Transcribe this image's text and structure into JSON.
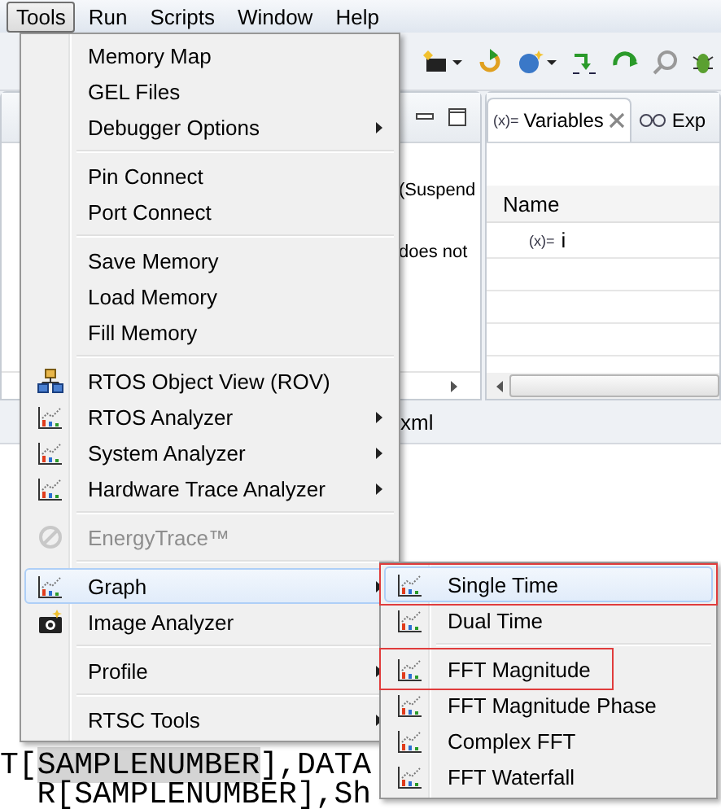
{
  "menubar": [
    {
      "label": "Tools",
      "selected": true
    },
    {
      "label": "Run",
      "selected": false
    },
    {
      "label": "Scripts",
      "selected": false
    },
    {
      "label": "Window",
      "selected": false
    },
    {
      "label": "Help",
      "selected": false
    }
  ],
  "debug_panel": {
    "texts": [
      "(Suspend",
      "does not"
    ]
  },
  "variables_panel": {
    "tabs": [
      {
        "label": "Variables",
        "icon_text": "(x)=",
        "selected": true
      },
      {
        "label": "Exp",
        "selected": false
      }
    ],
    "column": "Name",
    "rows": [
      {
        "icon_text": "(x)=",
        "name": "i"
      }
    ]
  },
  "editor_tab": {
    "label": "xml"
  },
  "code_lines": [
    {
      "parts": [
        {
          "text": "T[",
          "highlighted": false
        },
        {
          "text": "SAMPLENUMBER",
          "highlighted": true
        },
        {
          "text": "],DATA",
          "highlighted": false
        }
      ]
    },
    {
      "parts": [
        {
          "text": "  R[",
          "highlighted": false
        },
        {
          "text": "SAMPLENUMBER",
          "highlighted": false
        },
        {
          "text": "],Sh",
          "highlighted": false
        }
      ]
    }
  ],
  "tools_menu": {
    "items": [
      {
        "kind": "plain",
        "label": "Memory Map",
        "submenu": false,
        "disabled": false,
        "highlighted": false
      },
      {
        "kind": "plain",
        "label": "GEL Files",
        "submenu": false,
        "disabled": false,
        "highlighted": false
      },
      {
        "kind": "plain",
        "label": "Debugger Options",
        "submenu": true,
        "disabled": false,
        "highlighted": false
      },
      {
        "kind": "separator"
      },
      {
        "kind": "plain",
        "label": "Pin Connect",
        "submenu": false,
        "disabled": false,
        "highlighted": false
      },
      {
        "kind": "plain",
        "label": "Port Connect",
        "submenu": false,
        "disabled": false,
        "highlighted": false
      },
      {
        "kind": "separator"
      },
      {
        "kind": "plain",
        "label": "Save Memory",
        "submenu": false,
        "disabled": false,
        "highlighted": false
      },
      {
        "kind": "plain",
        "label": "Load Memory",
        "submenu": false,
        "disabled": false,
        "highlighted": false
      },
      {
        "kind": "plain",
        "label": "Fill Memory",
        "submenu": false,
        "disabled": false,
        "highlighted": false
      },
      {
        "kind": "separator"
      },
      {
        "kind": "hierarchy",
        "label": "RTOS Object View (ROV)",
        "submenu": false,
        "disabled": false,
        "highlighted": false
      },
      {
        "kind": "chart",
        "label": "RTOS Analyzer",
        "submenu": true,
        "disabled": false,
        "highlighted": false
      },
      {
        "kind": "chart",
        "label": "System Analyzer",
        "submenu": true,
        "disabled": false,
        "highlighted": false
      },
      {
        "kind": "chart",
        "label": "Hardware Trace Analyzer",
        "submenu": true,
        "disabled": false,
        "highlighted": false
      },
      {
        "kind": "separator"
      },
      {
        "kind": "gauge",
        "label": "EnergyTrace™",
        "submenu": false,
        "disabled": true,
        "highlighted": false
      },
      {
        "kind": "separator"
      },
      {
        "kind": "chart",
        "label": "Graph",
        "submenu": true,
        "disabled": false,
        "highlighted": true
      },
      {
        "kind": "camera",
        "label": "Image Analyzer",
        "submenu": false,
        "disabled": false,
        "highlighted": false
      },
      {
        "kind": "separator"
      },
      {
        "kind": "plain",
        "label": "Profile",
        "submenu": true,
        "disabled": false,
        "highlighted": false
      },
      {
        "kind": "separator"
      },
      {
        "kind": "plain",
        "label": "RTSC Tools",
        "submenu": true,
        "disabled": false,
        "highlighted": false
      }
    ]
  },
  "graph_submenu": {
    "items": [
      {
        "kind": "chart",
        "label": "Single Time",
        "highlighted": true,
        "annotated": true
      },
      {
        "kind": "chart",
        "label": "Dual Time",
        "highlighted": false,
        "annotated": false
      },
      {
        "kind": "separator"
      },
      {
        "kind": "chart",
        "label": "FFT Magnitude",
        "highlighted": false,
        "annotated": true
      },
      {
        "kind": "chart",
        "label": "FFT Magnitude Phase",
        "highlighted": false,
        "annotated": false
      },
      {
        "kind": "chart",
        "label": "Complex FFT",
        "highlighted": false,
        "annotated": false
      },
      {
        "kind": "chart",
        "label": "FFT Waterfall",
        "highlighted": false,
        "annotated": false
      }
    ]
  }
}
